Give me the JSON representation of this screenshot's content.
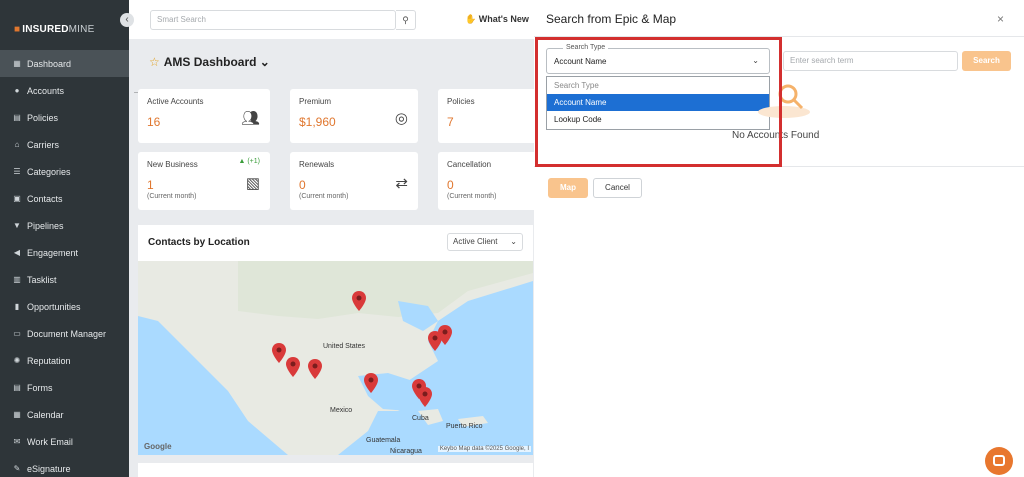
{
  "sidebar": {
    "logo": {
      "bold": "INSURED",
      "thin": "MINE"
    },
    "collapse_glyph": "‹",
    "items": [
      {
        "label": "Dashboard",
        "icon": "grid-icon",
        "glyph": "▦",
        "active": true
      },
      {
        "label": "Accounts",
        "icon": "users-icon",
        "glyph": "●"
      },
      {
        "label": "Policies",
        "icon": "document-icon",
        "glyph": "▤"
      },
      {
        "label": "Carriers",
        "icon": "bank-icon",
        "glyph": "⌂"
      },
      {
        "label": "Categories",
        "icon": "list-icon",
        "glyph": "☰"
      },
      {
        "label": "Contacts",
        "icon": "contact-card-icon",
        "glyph": "▣"
      },
      {
        "label": "Pipelines",
        "icon": "funnel-icon",
        "glyph": "▼"
      },
      {
        "label": "Engagement",
        "icon": "megaphone-icon",
        "glyph": "◀"
      },
      {
        "label": "Tasklist",
        "icon": "clipboard-icon",
        "glyph": "▥"
      },
      {
        "label": "Opportunities",
        "icon": "bar-chart-icon",
        "glyph": "▮"
      },
      {
        "label": "Document Manager",
        "icon": "folder-icon",
        "glyph": "▭"
      },
      {
        "label": "Reputation",
        "icon": "badge-icon",
        "glyph": "✺"
      },
      {
        "label": "Forms",
        "icon": "form-icon",
        "glyph": "▤"
      },
      {
        "label": "Calendar",
        "icon": "calendar-icon",
        "glyph": "▦"
      },
      {
        "label": "Work Email",
        "icon": "mail-icon",
        "glyph": "✉"
      },
      {
        "label": "eSignature",
        "icon": "signature-icon",
        "glyph": "✎"
      }
    ]
  },
  "topbar": {
    "search_placeholder": "Smart Search",
    "whats_new": "What's New"
  },
  "dashboard": {
    "title": "AMS Dashboard",
    "cards": [
      {
        "label": "Active Accounts",
        "value": "16",
        "icon": "users-icon"
      },
      {
        "label": "Premium",
        "value": "$1,960",
        "icon": "coin-icon"
      },
      {
        "label": "Policies",
        "value": "7"
      },
      {
        "label": "New Business",
        "value": "1",
        "sub": "(Current month)",
        "badge": "▲ (+1)",
        "icon": "contract-icon"
      },
      {
        "label": "Renewals",
        "value": "0",
        "sub": "(Current month)",
        "icon": "repeat-icon"
      },
      {
        "label": "Cancellation",
        "value": "0",
        "sub": "(Current month)"
      }
    ],
    "contacts_title": "Contacts by Location",
    "filter_value": "Active Client",
    "map_labels": {
      "us": "United States",
      "mexico": "Mexico",
      "cuba": "Cuba",
      "pr": "Puerto Rico",
      "guatemala": "Guatemala",
      "nicaragua": "Nicaragua"
    },
    "google": "Google",
    "map_attribution": "Keybo  Map data ©2025 Google, I"
  },
  "modal": {
    "title": "Search from Epic & Map",
    "close": "×",
    "search_type_legend": "Search Type",
    "search_type_value": "Account Name",
    "dropdown_options": [
      {
        "label": "Search Type",
        "state": "placeholder"
      },
      {
        "label": "Account Name",
        "state": "selected"
      },
      {
        "label": "Lookup Code",
        "state": "normal"
      }
    ],
    "term_placeholder": "Enter search term",
    "search_button": "Search",
    "no_accounts": "No Accounts Found",
    "map_button": "Map",
    "cancel_button": "Cancel"
  },
  "colors": {
    "accent": "#e0772f",
    "selected_option": "#1d6fd3",
    "highlight": "#d32f2f",
    "sidebar_bg": "#2e3539",
    "disabled_button": "#f9c48d"
  }
}
